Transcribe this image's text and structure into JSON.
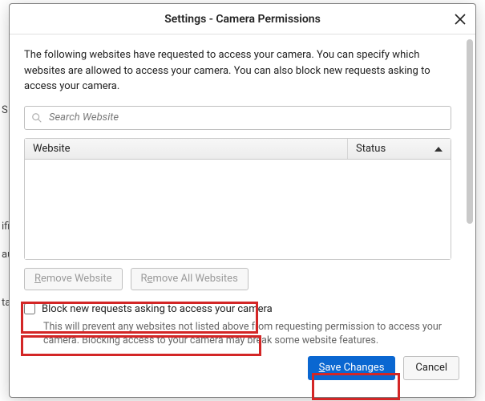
{
  "background_items": [
    "S",
    "ifi",
    "au",
    "ta"
  ],
  "dialog": {
    "title": "Settings - Camera Permissions",
    "description": "The following websites have requested to access your camera. You can specify which websites are allowed to access your camera. You can also block new requests asking to access your camera.",
    "search_placeholder": "Search Website",
    "columns": {
      "website": "Website",
      "status": "Status"
    },
    "remove_website": {
      "accel": "R",
      "rest": "emove Website"
    },
    "remove_all": {
      "prefix": "R",
      "accel": "e",
      "rest": "move All Websites"
    },
    "block_checkbox": "Block new requests asking to access your camera",
    "block_hint": "This will prevent any websites not listed above from requesting permission to access your camera. Blocking access to your camera may break some website features.",
    "save": {
      "accel": "S",
      "rest": "ave Changes"
    },
    "cancel": "Cancel"
  }
}
